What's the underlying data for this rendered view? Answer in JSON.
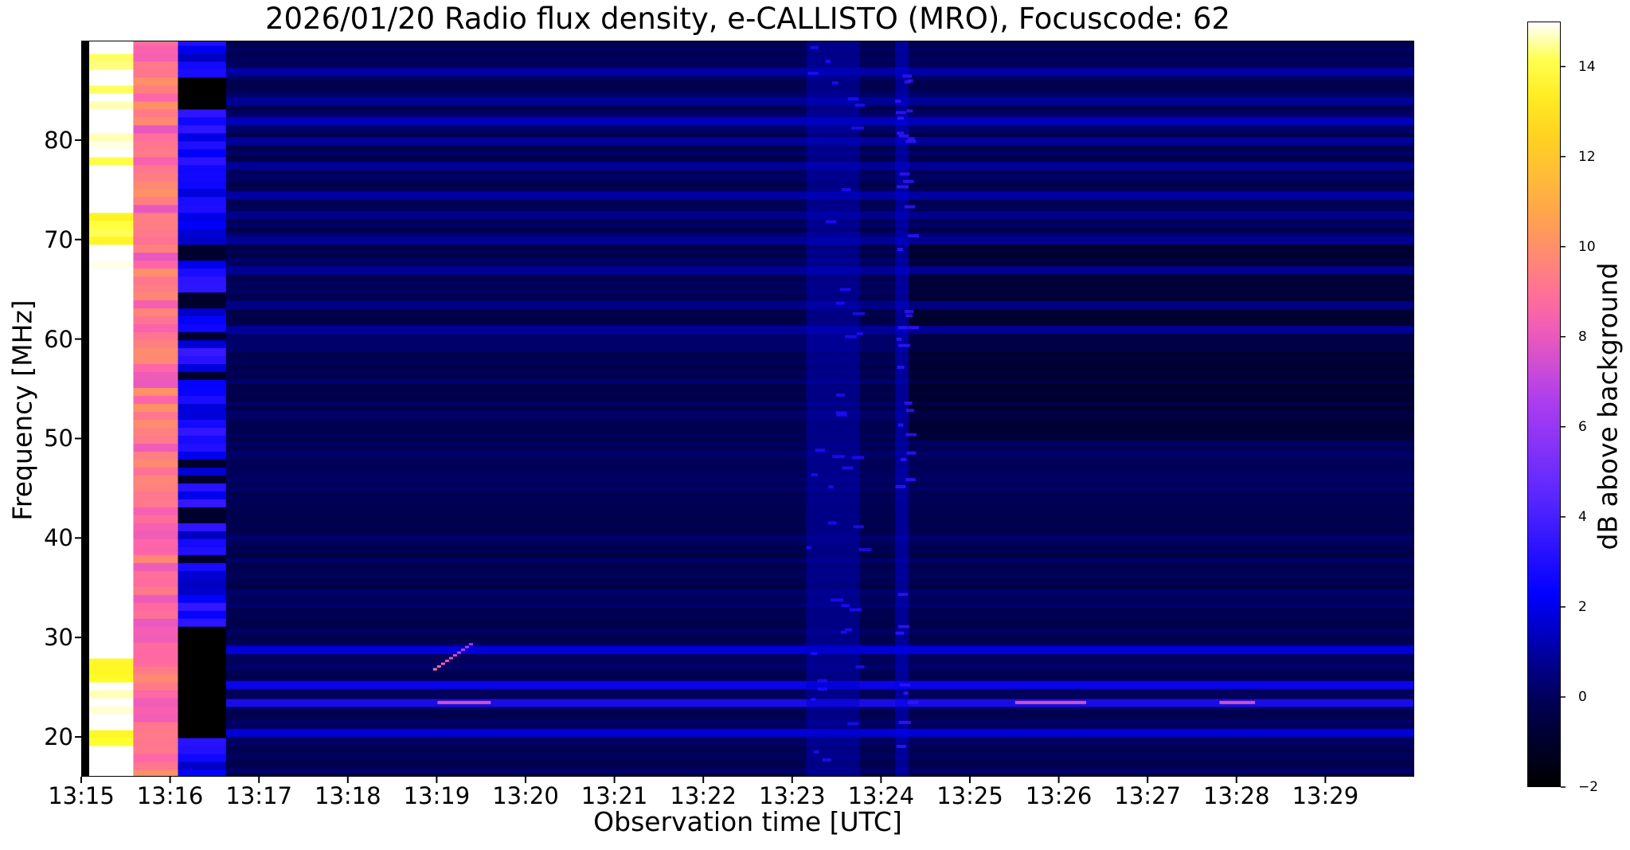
{
  "chart_data": {
    "type": "heatmap",
    "title": "2026/01/20  Radio flux density, e-CALLISTO (MRO), Focuscode: 62",
    "xlabel": "Observation time [UTC]",
    "ylabel": "Frequency [MHz]",
    "colorbar_label": "dB above background",
    "colormap": "gnuplot2",
    "x_range_minutes": [
      0,
      15
    ],
    "x_tick_labels": [
      "13:15",
      "13:16",
      "13:17",
      "13:18",
      "13:19",
      "13:20",
      "13:21",
      "13:22",
      "13:23",
      "13:24",
      "13:25",
      "13:26",
      "13:27",
      "13:28",
      "13:29"
    ],
    "ylim": [
      16,
      90
    ],
    "y_ticks": [
      20,
      30,
      40,
      50,
      60,
      70,
      80
    ],
    "y_tick_labels": [
      "20",
      "30",
      "40",
      "50",
      "60",
      "70",
      "80"
    ],
    "clim": [
      -2,
      15
    ],
    "colorbar_ticks": [
      -2,
      0,
      2,
      4,
      6,
      8,
      10,
      12,
      14
    ],
    "colorbar_tick_labels": [
      "−2",
      "0",
      "2",
      "4",
      "6",
      "8",
      "10",
      "12",
      "14"
    ],
    "background_level_db": 0,
    "calibration_blocks": [
      {
        "start_min": 0.08,
        "end_min": 0.58,
        "level_db": 15
      },
      {
        "start_min": 0.58,
        "end_min": 1.08,
        "level_db": 9
      },
      {
        "start_min": 1.08,
        "end_min": 1.62,
        "level_db": 2.5
      }
    ],
    "interference_bands_mhz": [
      {
        "freq": 20.5,
        "level_db": 2
      },
      {
        "freq": 23.5,
        "level_db": 3
      },
      {
        "freq": 25.3,
        "level_db": 2.5
      },
      {
        "freq": 28.8,
        "level_db": 2
      },
      {
        "freq": 61,
        "level_db": 1
      },
      {
        "freq": 63.5,
        "level_db": 0.8
      },
      {
        "freq": 67,
        "level_db": 1
      },
      {
        "freq": 70,
        "level_db": 1
      },
      {
        "freq": 72.5,
        "level_db": 0.8
      },
      {
        "freq": 74.5,
        "level_db": 1.2
      },
      {
        "freq": 77.5,
        "level_db": 1
      },
      {
        "freq": 80,
        "level_db": 1
      },
      {
        "freq": 82,
        "level_db": 1.5
      },
      {
        "freq": 84,
        "level_db": 1
      },
      {
        "freq": 87,
        "level_db": 1.2
      }
    ],
    "broadband_bursts": [
      {
        "start_min": 8.15,
        "end_min": 8.75,
        "level_db": 1.5
      },
      {
        "start_min": 9.15,
        "end_min": 9.3,
        "level_db": 2
      }
    ]
  }
}
